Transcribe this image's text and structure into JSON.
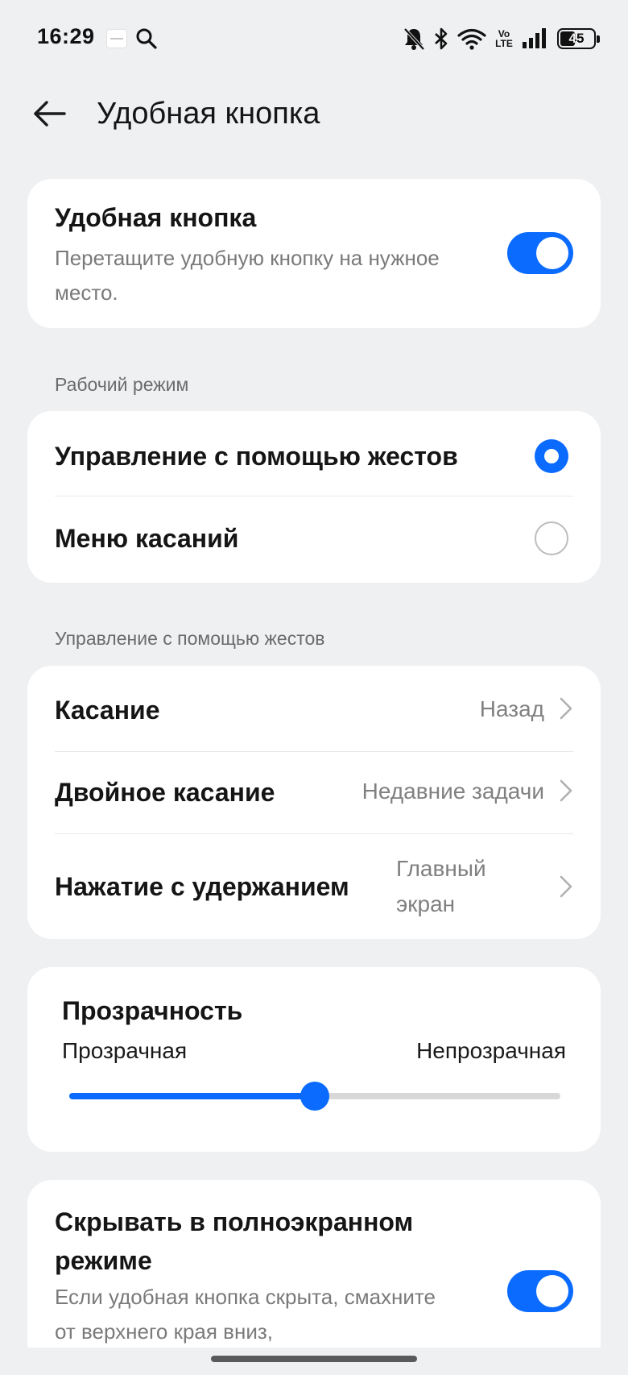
{
  "status_bar": {
    "time": "16:29",
    "battery": "45",
    "battery_level": 0.45,
    "volte_top": "Vo",
    "volte_bottom": "LTE",
    "icons": [
      "app-notification-icon",
      "search-icon",
      "bell-muted-icon",
      "bluetooth-icon",
      "wifi-icon",
      "volte-icon",
      "signal-icon",
      "battery-icon"
    ]
  },
  "header": {
    "title": "Удобная кнопка",
    "back_icon": "arrow-left-icon"
  },
  "main_toggle": {
    "title": "Удобная кнопка",
    "subtitle": "Перетащите удобную кнопку на нужное место.",
    "enabled": true
  },
  "work_mode": {
    "section_label": "Рабочий режим",
    "options": [
      {
        "label": "Управление с помощью жестов",
        "selected": true
      },
      {
        "label": "Меню касаний",
        "selected": false
      }
    ]
  },
  "gestures": {
    "section_label": "Управление с помощью жестов",
    "items": [
      {
        "label": "Касание",
        "value": "Назад"
      },
      {
        "label": "Двойное касание",
        "value": "Недавние задачи"
      },
      {
        "label": "Нажатие с удержанием",
        "value": "Главный экран"
      }
    ]
  },
  "transparency": {
    "title": "Прозрачность",
    "min_label": "Прозрачная",
    "max_label": "Непрозрачная",
    "value": 0.5
  },
  "fullscreen": {
    "title": "Скрывать в полноэкранном режиме",
    "subtitle": "Если удобная кнопка скрыта, смахните от верхнего края вниз,",
    "enabled": true
  },
  "colors": {
    "accent": "#0b6bff",
    "background": "#eff0f2",
    "card": "#ffffff"
  }
}
